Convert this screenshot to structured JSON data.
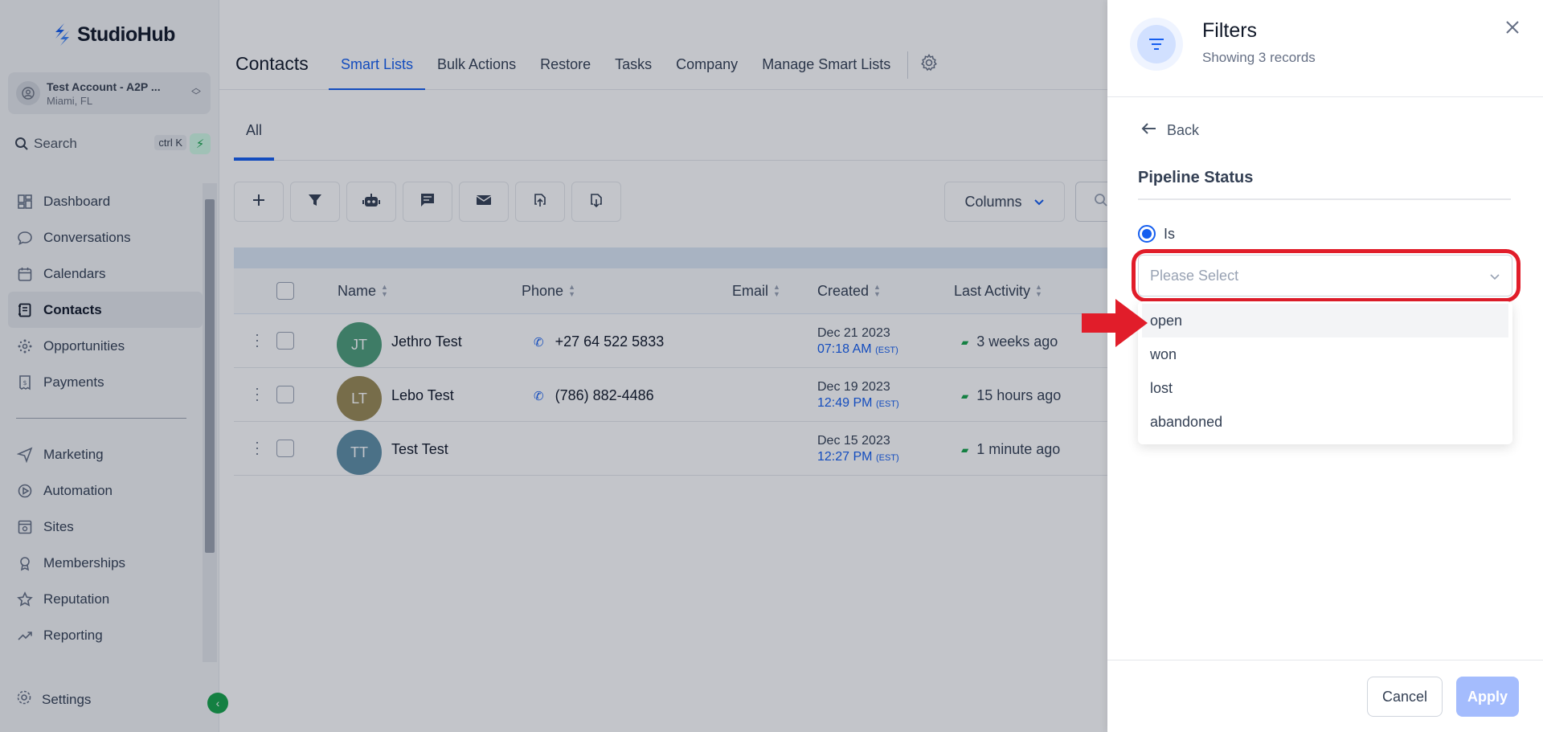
{
  "brand": {
    "name": "StudioHub"
  },
  "account": {
    "name": "Test Account - A2P ...",
    "location": "Miami, FL"
  },
  "sidebar_search": {
    "label": "Search",
    "shortcut": "ctrl K"
  },
  "sidebar": {
    "items": [
      {
        "label": "Dashboard",
        "icon": "dashboard-icon"
      },
      {
        "label": "Conversations",
        "icon": "chat-icon"
      },
      {
        "label": "Calendars",
        "icon": "calendar-icon"
      },
      {
        "label": "Contacts",
        "icon": "contacts-icon",
        "active": true
      },
      {
        "label": "Opportunities",
        "icon": "opportunities-icon"
      },
      {
        "label": "Payments",
        "icon": "payments-icon"
      }
    ],
    "items2": [
      {
        "label": "Marketing",
        "icon": "send-icon"
      },
      {
        "label": "Automation",
        "icon": "automation-icon"
      },
      {
        "label": "Sites",
        "icon": "sites-icon"
      },
      {
        "label": "Memberships",
        "icon": "memberships-icon"
      },
      {
        "label": "Reputation",
        "icon": "star-icon"
      },
      {
        "label": "Reporting",
        "icon": "reporting-icon"
      }
    ],
    "settings_label": "Settings"
  },
  "header": {
    "title": "Contacts",
    "tabs": [
      "Smart Lists",
      "Bulk Actions",
      "Restore",
      "Tasks",
      "Company",
      "Manage Smart Lists"
    ]
  },
  "subtab": "All",
  "toolbar": {
    "columns_label": "Columns"
  },
  "table": {
    "columns": [
      "Name",
      "Phone",
      "Email",
      "Created",
      "Last Activity"
    ],
    "rows": [
      {
        "initials": "JT",
        "name": "Jethro Test",
        "phone": "+27 64 522 5833",
        "created_date": "Dec 21 2023",
        "created_time": "07:18 AM",
        "tz": "(EST)",
        "activity": "3 weeks ago",
        "color": "#4e9e7a"
      },
      {
        "initials": "LT",
        "name": "Lebo Test",
        "phone": "(786) 882-4486",
        "created_date": "Dec 19 2023",
        "created_time": "12:49 PM",
        "tz": "(EST)",
        "activity": "15 hours ago",
        "color": "#9a8a55"
      },
      {
        "initials": "TT",
        "name": "Test Test",
        "phone": "",
        "created_date": "Dec 15 2023",
        "created_time": "12:27 PM",
        "tz": "(EST)",
        "activity": "1 minute ago",
        "color": "#5f8fa6"
      }
    ]
  },
  "filters": {
    "title": "Filters",
    "subtitle": "Showing 3 records",
    "back_label": "Back",
    "section": "Pipeline Status",
    "radio_label": "Is",
    "select_placeholder": "Please Select",
    "options": [
      "open",
      "won",
      "lost",
      "abandoned"
    ],
    "cancel_label": "Cancel",
    "apply_label": "Apply"
  },
  "colors": {
    "accent": "#155eef",
    "highlight": "#e11d2a",
    "bolt": "#16a34a"
  }
}
